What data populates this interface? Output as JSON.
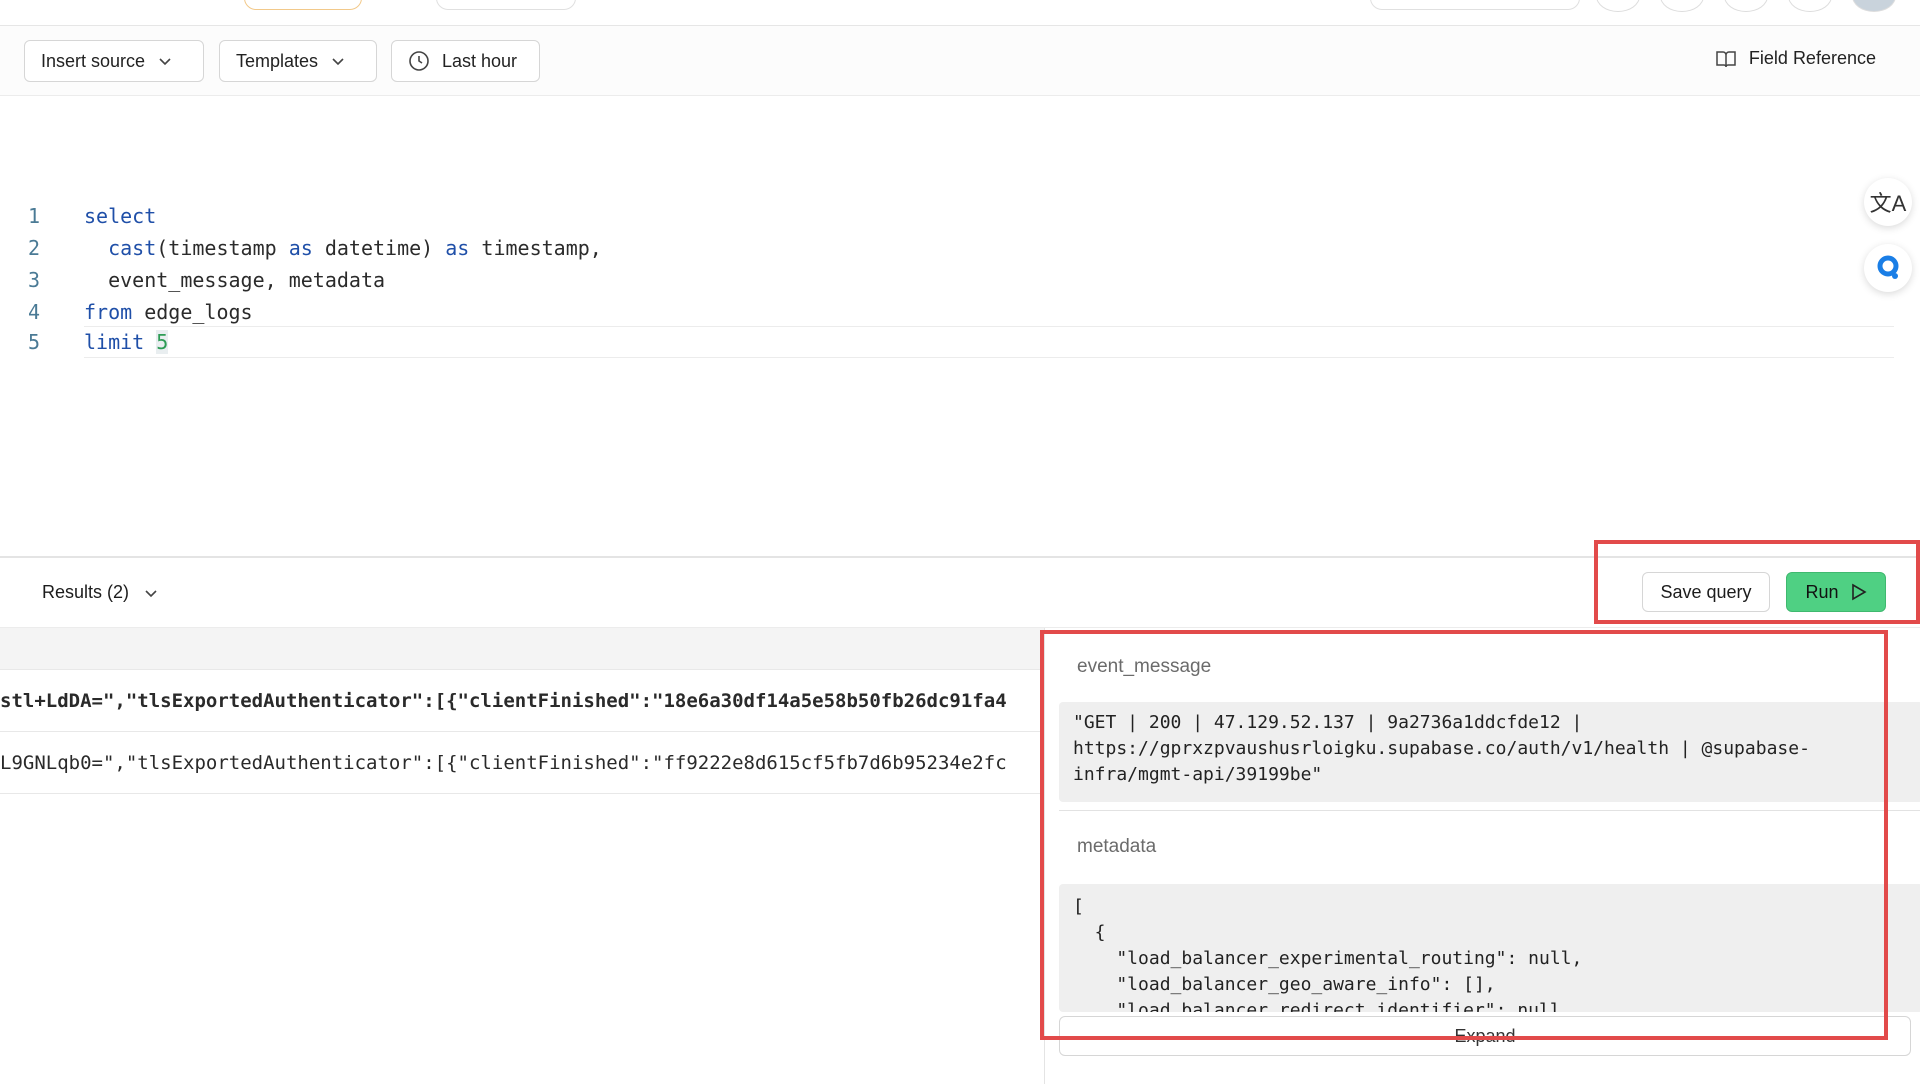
{
  "toolbar": {
    "insert_source_label": "Insert source",
    "templates_label": "Templates",
    "time_range_label": "Last hour",
    "field_reference_label": "Field Reference"
  },
  "editor": {
    "lines": [
      {
        "num": "1",
        "text": "select"
      },
      {
        "num": "2",
        "text": "  cast(timestamp as datetime) as timestamp,"
      },
      {
        "num": "3",
        "text": "  event_message, metadata"
      },
      {
        "num": "4",
        "text": "from edge_logs"
      },
      {
        "num": "5",
        "text": "limit 5"
      }
    ]
  },
  "results": {
    "label": "Results (2)",
    "save_label": "Save query",
    "run_label": "Run",
    "rows": [
      "stl+LdDA=\",\"tlsExportedAuthenticator\":[{\"clientFinished\":\"18e6a30df14a5e58b50fb26dc91fa4",
      "L9GNLqb0=\",\"tlsExportedAuthenticator\":[{\"clientFinished\":\"ff9222e8d615cf5fb7d6b95234e2fc"
    ]
  },
  "detail": {
    "event_message_label": "event_message",
    "event_message_value": "\"GET | 200 | 47.129.52.137 | 9a2736a1ddcfde12 |\nhttps://gprxzpvaushusrloigku.supabase.co/auth/v1/health | @supabase-\ninfra/mgmt-api/39199be\"",
    "metadata_label": "metadata",
    "metadata_value": "[\n  {\n    \"load_balancer_experimental_routing\": null,\n    \"load_balancer_geo_aware_info\": [],\n    \"load_balancer_redirect_identifier\": null,",
    "expand_label": "Expand"
  },
  "colors": {
    "run_accent": "#4fd083",
    "highlight_border": "#e24a4a"
  }
}
